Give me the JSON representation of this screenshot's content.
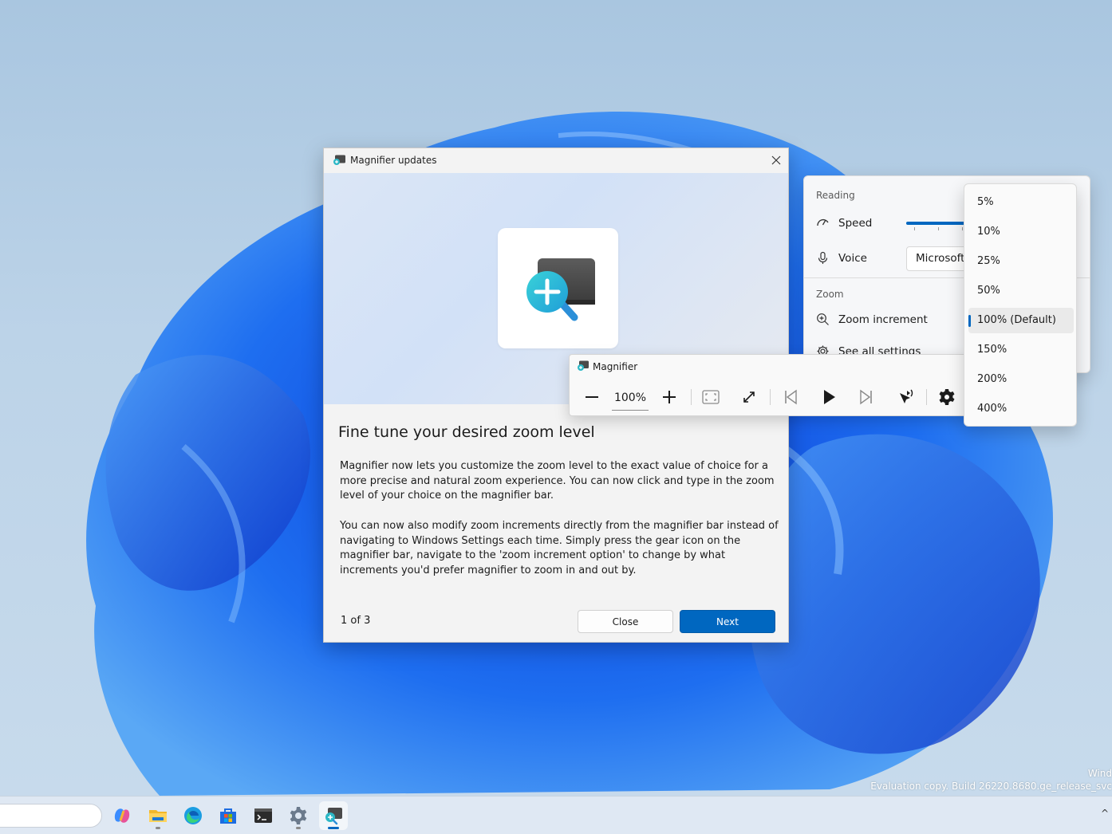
{
  "desktop": {
    "watermark_line1": "Wind",
    "watermark_line2": "Evaluation copy. Build 26220.8680.ge_release_svc"
  },
  "taskbar": {
    "icons": [
      "copilot-icon",
      "file-explorer-icon",
      "edge-icon",
      "store-icon",
      "terminal-icon",
      "settings-icon",
      "magnifier-icon"
    ],
    "active": "magnifier-icon",
    "chevron": "^"
  },
  "dialog": {
    "title": "Magnifier updates",
    "heading": "Fine tune your desired zoom level",
    "paragraph1": "Magnifier now lets you customize the zoom level to the exact value of choice for a more precise and natural zoom experience. You can now click and type in the zoom level of your choice on the magnifier bar.",
    "paragraph2": "You can now also modify zoom increments directly from the magnifier bar instead of navigating to Windows Settings each time. Simply press the gear icon on the magnifier bar, navigate to the 'zoom increment option' to change by what increments you'd prefer magnifier to zoom in and out by.",
    "page_indicator": "1 of 3",
    "close_label": "Close",
    "next_label": "Next",
    "accent": "#0067c0"
  },
  "magnifier_bar": {
    "title": "Magnifier",
    "zoom_value": "100%"
  },
  "settings_flyout": {
    "reading_header": "Reading",
    "speed_label": "Speed",
    "voice_label": "Voice",
    "voice_value": "Microsoft",
    "zoom_header": "Zoom",
    "zoom_increment_label": "Zoom increment",
    "see_all_label": "See all settings"
  },
  "zoom_increment_dropdown": {
    "options": [
      "5%",
      "10%",
      "25%",
      "50%",
      "100% (Default)",
      "150%",
      "200%",
      "400%"
    ],
    "selected": "100% (Default)"
  }
}
